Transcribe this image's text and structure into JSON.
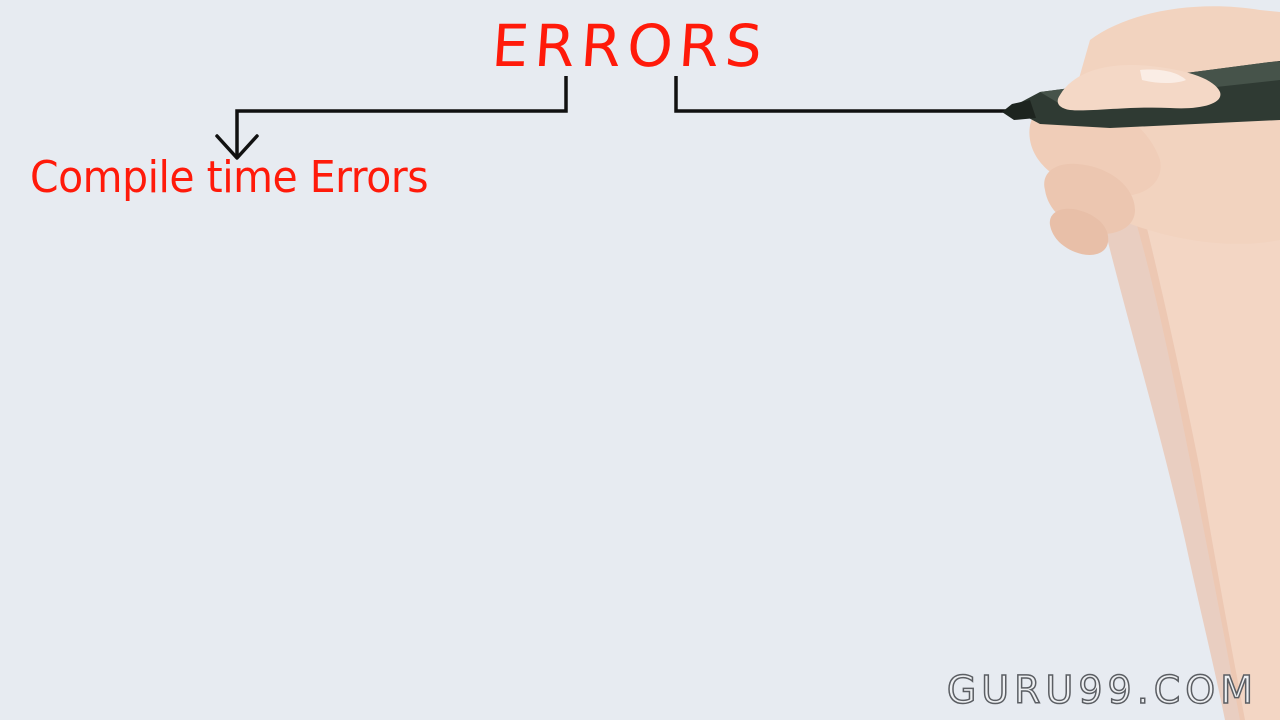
{
  "diagram": {
    "root": {
      "label": "ERRORS"
    },
    "branches": [
      {
        "label": "Compile time Errors"
      }
    ]
  },
  "watermark": {
    "text": "GURU99.COM"
  },
  "colors": {
    "background": "#e7ebf1",
    "text_accent": "#ff1a0a",
    "connector": "#111111",
    "marker_body": "#2f3a33"
  },
  "icons": [
    "hand-with-marker"
  ]
}
